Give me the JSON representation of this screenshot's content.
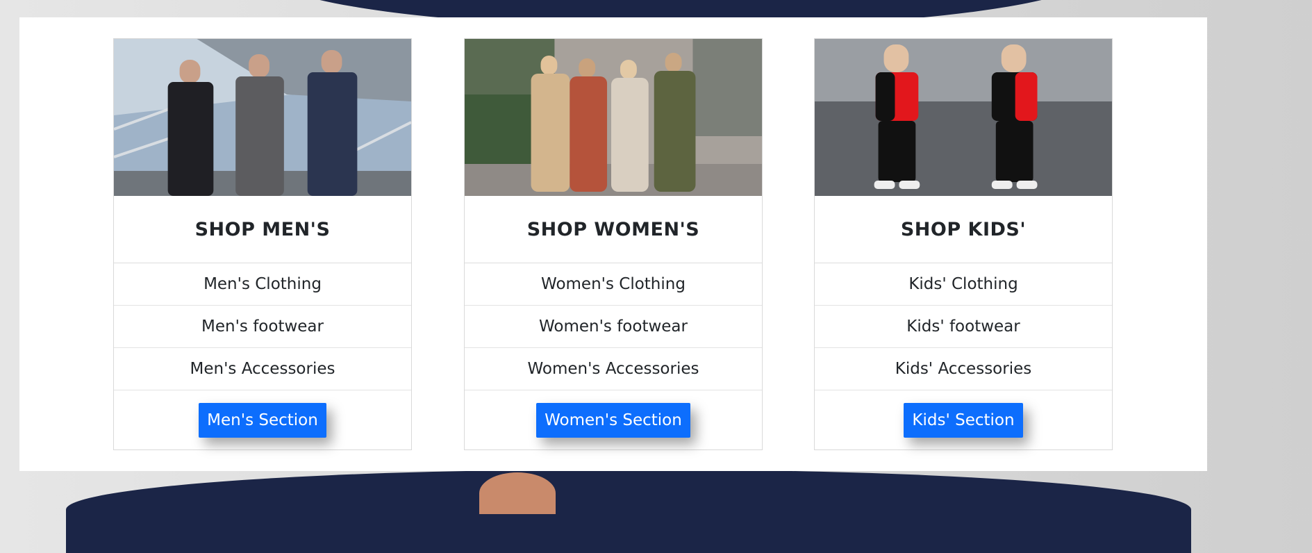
{
  "cards": [
    {
      "title": "SHOP MEN'S",
      "image_alt": "men-group-photo",
      "items": [
        "Men's Clothing",
        "Men's footwear",
        "Men's Accessories"
      ],
      "button_label": "Men's Section"
    },
    {
      "title": "SHOP WOMEN'S",
      "image_alt": "women-group-photo",
      "items": [
        "Women's Clothing",
        "Women's footwear",
        "Women's Accessories"
      ],
      "button_label": "Women's Section"
    },
    {
      "title": "SHOP KIDS'",
      "image_alt": "kids-photo",
      "items": [
        "Kids' Clothing",
        "Kids' footwear",
        "Kids' Accessories"
      ],
      "button_label": "Kids' Section"
    }
  ],
  "colors": {
    "button": "#0d6efd",
    "background_figure": "#1b2547"
  }
}
